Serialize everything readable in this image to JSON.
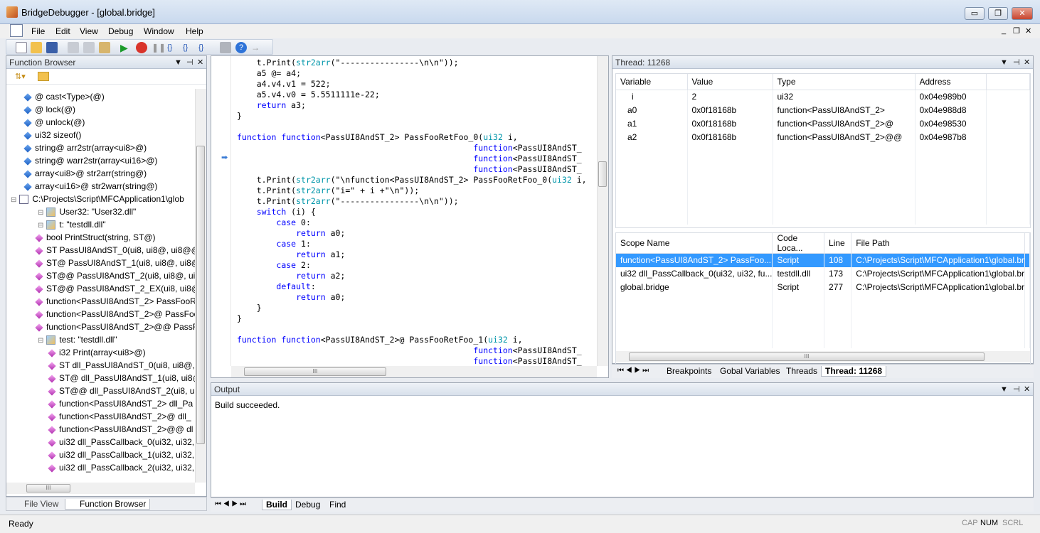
{
  "window": {
    "title": "BridgeDebugger - [global.bridge]",
    "min": "▭",
    "max": "❐",
    "close": "✕"
  },
  "menu": [
    "File",
    "Edit",
    "View",
    "Debug",
    "Window",
    "Help"
  ],
  "function_browser": {
    "title": "Function Browser",
    "items": [
      {
        "text": "@ cast<Type>(@)",
        "icon": "blue",
        "indent": 0
      },
      {
        "text": "@ lock(@)",
        "icon": "blue",
        "indent": 0
      },
      {
        "text": "@ unlock(@)",
        "icon": "blue",
        "indent": 0
      },
      {
        "text": "ui32 sizeof()",
        "icon": "blue",
        "indent": 0
      },
      {
        "text": "string@ arr2str(array<ui8>@)",
        "icon": "blue",
        "indent": 0
      },
      {
        "text": "string@ warr2str(array<ui16>@)",
        "icon": "blue",
        "indent": 0
      },
      {
        "text": "array<ui8>@ str2arr(string@)",
        "icon": "blue",
        "indent": 0
      },
      {
        "text": "array<ui16>@ str2warr(string@)",
        "icon": "blue",
        "indent": 0
      },
      {
        "text": "C:\\Projects\\Script\\MFCApplication1\\glob",
        "icon": "file",
        "indent": -1
      },
      {
        "text": "User32: \"User32.dll\"",
        "icon": "lib",
        "indent": 1
      },
      {
        "text": "t: \"testdll.dll\"",
        "icon": "lib",
        "indent": 1
      },
      {
        "text": "bool PrintStruct(string, ST@)",
        "icon": "pink",
        "indent": 1
      },
      {
        "text": "ST PassUI8AndST_0(ui8, ui8@, ui8@@,",
        "icon": "pink",
        "indent": 1
      },
      {
        "text": "ST@ PassUI8AndST_1(ui8, ui8@, ui8@",
        "icon": "pink",
        "indent": 1
      },
      {
        "text": "ST@@ PassUI8AndST_2(ui8, ui8@, ui8",
        "icon": "pink",
        "indent": 1
      },
      {
        "text": "ST@@ PassUI8AndST_2_EX(ui8, ui8@,",
        "icon": "pink",
        "indent": 1
      },
      {
        "text": "function<PassUI8AndST_2> PassFooR",
        "icon": "pink",
        "indent": 1
      },
      {
        "text": "function<PassUI8AndST_2>@ PassFoo",
        "icon": "pink",
        "indent": 1
      },
      {
        "text": "function<PassUI8AndST_2>@@ PassF",
        "icon": "pink",
        "indent": 1
      },
      {
        "text": "test: \"testdll.dll\"",
        "icon": "lib",
        "indent": 1
      },
      {
        "text": "i32 Print(array<ui8>@)",
        "icon": "pink",
        "indent": 2
      },
      {
        "text": "ST dll_PassUI8AndST_0(ui8, ui8@, u",
        "icon": "pink",
        "indent": 2
      },
      {
        "text": "ST@ dll_PassUI8AndST_1(ui8, ui8@",
        "icon": "pink",
        "indent": 2
      },
      {
        "text": "ST@@ dll_PassUI8AndST_2(ui8, ui8",
        "icon": "pink",
        "indent": 2
      },
      {
        "text": "function<PassUI8AndST_2> dll_Pa",
        "icon": "pink",
        "indent": 2
      },
      {
        "text": "function<PassUI8AndST_2>@ dll_",
        "icon": "pink",
        "indent": 2
      },
      {
        "text": "function<PassUI8AndST_2>@@ dl",
        "icon": "pink",
        "indent": 2
      },
      {
        "text": "ui32 dll_PassCallback_0(ui32, ui32,",
        "icon": "pink",
        "indent": 2
      },
      {
        "text": "ui32 dll_PassCallback_1(ui32, ui32,",
        "icon": "pink",
        "indent": 2
      },
      {
        "text": "ui32 dll_PassCallback_2(ui32, ui32,",
        "icon": "pink",
        "indent": 2
      }
    ],
    "hscroll": "III",
    "tabs": [
      "File View",
      "Function Browser"
    ]
  },
  "editor": {
    "lines": [
      [
        [
          "    t.Print(",
          ""
        ],
        [
          "str2arr",
          "ty"
        ],
        [
          "(\"----------------\\n\\n\"));",
          ""
        ]
      ],
      [
        [
          "    a5 @= a4;",
          ""
        ]
      ],
      [
        [
          "    a4.v4.v1 = 522;",
          ""
        ]
      ],
      [
        [
          "    a5.v4.v0 = 5.5511111e-22;",
          ""
        ]
      ],
      [
        [
          "    ",
          ""
        ],
        [
          "return",
          "kw"
        ],
        [
          " a3;",
          ""
        ]
      ],
      [
        [
          "}",
          ""
        ]
      ],
      [
        [
          "",
          ""
        ]
      ],
      [
        [
          "function",
          "kw"
        ],
        [
          " ",
          ""
        ],
        [
          "function",
          "kw"
        ],
        [
          "<PassUI8AndST_2> PassFooRetFoo_0(",
          ""
        ],
        [
          "ui32",
          "ty"
        ],
        [
          " i,",
          ""
        ]
      ],
      [
        [
          "                                                ",
          ""
        ],
        [
          "function",
          "kw"
        ],
        [
          "<PassUI8AndST_",
          ""
        ]
      ],
      [
        [
          "                                                ",
          ""
        ],
        [
          "function",
          "kw"
        ],
        [
          "<PassUI8AndST_",
          ""
        ]
      ],
      [
        [
          "                                                ",
          ""
        ],
        [
          "function",
          "kw"
        ],
        [
          "<PassUI8AndST_",
          ""
        ]
      ],
      [
        [
          "    t.Print(",
          ""
        ],
        [
          "str2arr",
          "ty"
        ],
        [
          "(\"\\nfunction<PassUI8AndST_2> PassFooRetFoo_0(",
          ""
        ],
        [
          "ui32",
          "ty"
        ],
        [
          " i,",
          ""
        ]
      ],
      [
        [
          "    t.Print(",
          ""
        ],
        [
          "str2arr",
          "ty"
        ],
        [
          "(\"i=\" + i +\"\\n\"));",
          ""
        ]
      ],
      [
        [
          "    t.Print(",
          ""
        ],
        [
          "str2arr",
          "ty"
        ],
        [
          "(\"----------------\\n\\n\"));",
          ""
        ]
      ],
      [
        [
          "    ",
          ""
        ],
        [
          "switch",
          "kw"
        ],
        [
          " (i) {",
          ""
        ]
      ],
      [
        [
          "        ",
          ""
        ],
        [
          "case",
          "kw"
        ],
        [
          " 0:",
          ""
        ]
      ],
      [
        [
          "            ",
          ""
        ],
        [
          "return",
          "kw"
        ],
        [
          " a0;",
          ""
        ]
      ],
      [
        [
          "        ",
          ""
        ],
        [
          "case",
          "kw"
        ],
        [
          " 1:",
          ""
        ]
      ],
      [
        [
          "            ",
          ""
        ],
        [
          "return",
          "kw"
        ],
        [
          " a1;",
          ""
        ]
      ],
      [
        [
          "        ",
          ""
        ],
        [
          "case",
          "kw"
        ],
        [
          " 2:",
          ""
        ]
      ],
      [
        [
          "            ",
          ""
        ],
        [
          "return",
          "kw"
        ],
        [
          " a2;",
          ""
        ]
      ],
      [
        [
          "        ",
          ""
        ],
        [
          "default",
          "kw"
        ],
        [
          ":",
          ""
        ]
      ],
      [
        [
          "            ",
          ""
        ],
        [
          "return",
          "kw"
        ],
        [
          " a0;",
          ""
        ]
      ],
      [
        [
          "    }",
          ""
        ]
      ],
      [
        [
          "}",
          ""
        ]
      ],
      [
        [
          "",
          ""
        ]
      ],
      [
        [
          "function",
          "kw"
        ],
        [
          " ",
          ""
        ],
        [
          "function",
          "kw"
        ],
        [
          "<PassUI8AndST_2>@ PassFooRetFoo_1(",
          ""
        ],
        [
          "ui32",
          "ty"
        ],
        [
          " i,",
          ""
        ]
      ],
      [
        [
          "                                                ",
          ""
        ],
        [
          "function",
          "kw"
        ],
        [
          "<PassUI8AndST_",
          ""
        ]
      ],
      [
        [
          "                                                ",
          ""
        ],
        [
          "function",
          "kw"
        ],
        [
          "<PassUI8AndST_",
          ""
        ]
      ]
    ],
    "current_line_marker": "➡",
    "hscroll": "III"
  },
  "thread_panel": {
    "title": "Thread: 11268",
    "var_columns": [
      "Variable",
      "Value",
      "Type",
      "Address"
    ],
    "variables": [
      [
        "i",
        "2",
        "ui32",
        "0x04e989b0"
      ],
      [
        "a0",
        "0x0f18168b",
        "function<PassUI8AndST_2>",
        "0x04e988d8"
      ],
      [
        "a1",
        "0x0f18168b",
        "function<PassUI8AndST_2>@",
        "0x04e98530"
      ],
      [
        "a2",
        "0x0f18168b",
        "function<PassUI8AndST_2>@@",
        "0x04e987b8"
      ]
    ],
    "stack_columns": [
      "Scope Name",
      "Code Loca...",
      "Line",
      "File Path"
    ],
    "stack": [
      [
        "function<PassUI8AndST_2> PassFoo...",
        "Script",
        "108",
        "C:\\Projects\\Script\\MFCApplication1\\global.br"
      ],
      [
        "ui32 dll_PassCallback_0(ui32, ui32, fu...",
        "testdll.dll",
        "173",
        "C:\\Projects\\Script\\MFCApplication1\\global.br"
      ],
      [
        "global.bridge",
        "Script",
        "277",
        "C:\\Projects\\Script\\MFCApplication1\\global.br"
      ]
    ],
    "hscroll": "III",
    "tabs": [
      "Breakpoints",
      "Gobal Variables",
      "Threads",
      "Thread: 11268"
    ]
  },
  "output": {
    "title": "Output",
    "text": "Build succeeded.",
    "tabs": [
      "Build",
      "Debug",
      "Find"
    ]
  },
  "status": {
    "text": "Ready",
    "cap": "CAP",
    "num": "NUM",
    "scrl": "SCRL"
  },
  "ctl": {
    "dropdown": "▼",
    "pin": "⊣",
    "close": "✕"
  }
}
